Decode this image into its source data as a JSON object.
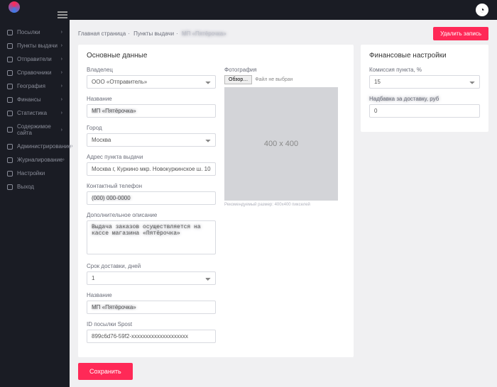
{
  "topbar": {
    "avatar_glyph": "◔"
  },
  "sidebar": {
    "items": [
      {
        "label": "Посылки",
        "expandable": true
      },
      {
        "label": "Пункты выдачи",
        "expandable": true
      },
      {
        "label": "Отправители",
        "expandable": true
      },
      {
        "label": "Справочники",
        "expandable": true
      },
      {
        "label": "География",
        "expandable": true
      },
      {
        "label": "Финансы",
        "expandable": true
      },
      {
        "label": "Статистика",
        "expandable": true
      },
      {
        "label": "Содержимое сайта",
        "expandable": true
      },
      {
        "label": "Администрирование",
        "expandable": true
      },
      {
        "label": "Журналирование",
        "expandable": true
      },
      {
        "label": "Настройки",
        "expandable": false
      },
      {
        "label": "Выход",
        "expandable": false
      }
    ]
  },
  "breadcrumb": {
    "home": "Главная страница",
    "section": "Пункты выдачи",
    "current": "МП «Пятёрочка»"
  },
  "buttons": {
    "delete": "Удалить запись",
    "save": "Сохранить",
    "browse": "Обзор…"
  },
  "main_card": {
    "title": "Основные данные",
    "fields": {
      "owner_label": "Владелец",
      "owner_value": "ООО «Отправитель»",
      "name_label": "Название",
      "name_value": "МП «Пятёрочка»",
      "city_label": "Город",
      "city_value": "Москва",
      "address_label": "Адрес пункта выдачи",
      "address_value": "Москва г, Куркино мкр. Новокуркинское ш. 10",
      "phone_label": "Контактный телефон",
      "phone_value": "(000) 000-0000",
      "desc_label": "Дополнительное описание",
      "desc_value": "Выдача заказов осуществляется на кассе магазина «Пятёрочка»",
      "delivery_label": "Срок доставки, дней",
      "delivery_value": "1",
      "name2_label": "Название",
      "name2_value": "МП «Пятёрочка»",
      "spsr_label": "ID посылки Spost",
      "spsr_value": "899c6d76-59f2-xxxxxxxxxxxxxxxxxxxx"
    },
    "photo": {
      "label": "Фотография",
      "no_file": "Файл не выбран",
      "placeholder_text": "400 x 400",
      "hint": "Рекомендуемый размер: 400x400 пикселей"
    }
  },
  "fin_card": {
    "title": "Финансовые настройки",
    "commission_label": "Комиссия пункта, %",
    "commission_value": "15",
    "bonus_label": "Надбавка за доставку, руб",
    "bonus_value": "0"
  }
}
